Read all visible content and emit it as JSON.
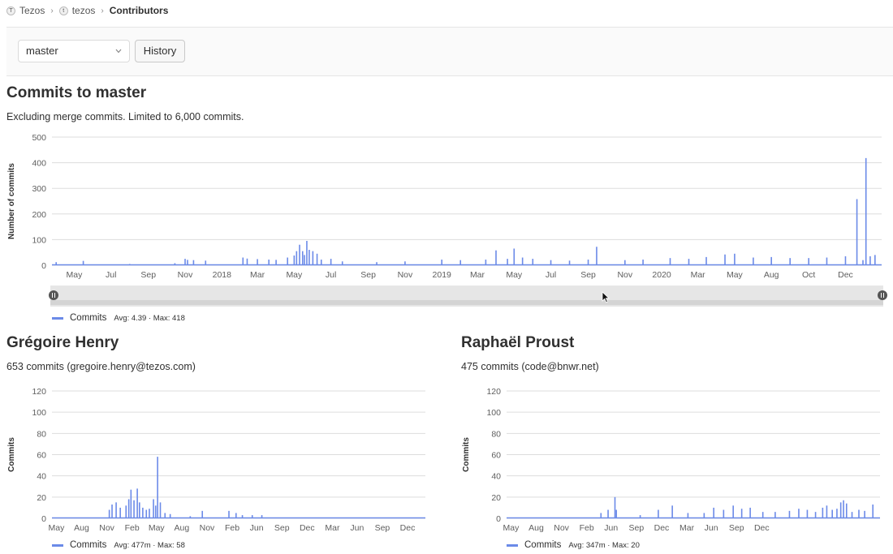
{
  "breadcrumb": {
    "items": [
      "Tezos",
      "tezos",
      "Contributors"
    ]
  },
  "toolbar": {
    "branch": "master",
    "history_label": "History"
  },
  "main": {
    "title": "Commits to master",
    "subtitle": "Excluding merge commits. Limited to 6,000 commits.",
    "legend": {
      "name": "Commits",
      "stats": "Avg: 4.39 · Max: 418"
    }
  },
  "contributors": [
    {
      "name": "Grégoire Henry",
      "summary": "653 commits (gregoire.henry@tezos.com)",
      "legend": {
        "name": "Commits",
        "stats": "Avg: 477m · Max: 58"
      }
    },
    {
      "name": "Raphaël Proust",
      "summary": "475 commits (code@bnwr.net)",
      "legend": {
        "name": "Commits",
        "stats": "Avg: 347m · Max: 20"
      }
    }
  ],
  "colors": {
    "series": "#6b8ae8",
    "grid": "#dddddd",
    "axis_text": "#5e5e5e",
    "slider_bg": "#e6e6e6"
  },
  "chart_data": [
    {
      "type": "area",
      "ylabel": "Number of commits",
      "ylim": [
        0,
        500
      ],
      "yticks": [
        0,
        100,
        200,
        300,
        400,
        500
      ],
      "x_ticks": [
        "May",
        "Jul",
        "Sep",
        "Nov",
        "2018",
        "Mar",
        "May",
        "Jul",
        "Sep",
        "Nov",
        "2019",
        "Mar",
        "May",
        "Jul",
        "Sep",
        "Nov",
        "2020",
        "Mar",
        "May",
        "Aug",
        "Oct",
        "Dec"
      ],
      "series": [
        {
          "name": "Commits",
          "x": [
            "2017-04-01",
            "2017-05-16",
            "2017-08-01",
            "2017-10-15",
            "2017-11-01",
            "2017-11-05",
            "2017-11-15",
            "2017-12-05",
            "2018-02-05",
            "2018-02-12",
            "2018-03-01",
            "2018-03-20",
            "2018-04-01",
            "2018-04-20",
            "2018-05-01",
            "2018-05-05",
            "2018-05-10",
            "2018-05-15",
            "2018-05-18",
            "2018-05-22",
            "2018-05-26",
            "2018-06-01",
            "2018-06-08",
            "2018-06-15",
            "2018-07-01",
            "2018-07-20",
            "2018-09-15",
            "2018-11-01",
            "2019-01-01",
            "2019-02-01",
            "2019-03-15",
            "2019-04-01",
            "2019-04-20",
            "2019-05-01",
            "2019-05-15",
            "2019-06-01",
            "2019-07-01",
            "2019-08-01",
            "2019-09-01",
            "2019-09-15",
            "2019-11-01",
            "2019-12-01",
            "2020-01-15",
            "2020-02-15",
            "2020-03-15",
            "2020-04-15",
            "2020-05-01",
            "2020-06-01",
            "2020-07-01",
            "2020-08-01",
            "2020-09-01",
            "2020-10-01",
            "2020-11-01",
            "2020-11-20",
            "2020-11-30",
            "2020-12-05",
            "2020-12-12",
            "2020-12-20"
          ],
          "values": [
            12,
            17,
            5,
            8,
            25,
            21,
            20,
            18,
            30,
            26,
            24,
            22,
            21,
            30,
            38,
            55,
            80,
            55,
            40,
            95,
            60,
            55,
            45,
            22,
            25,
            15,
            12,
            15,
            22,
            20,
            22,
            58,
            25,
            65,
            30,
            25,
            20,
            18,
            22,
            72,
            20,
            22,
            28,
            25,
            32,
            42,
            45,
            30,
            32,
            28,
            28,
            30,
            35,
            258,
            20,
            418,
            35,
            40
          ]
        }
      ]
    },
    {
      "type": "area",
      "ylabel": "Commits",
      "ylim": [
        0,
        120
      ],
      "yticks": [
        0,
        20,
        40,
        60,
        80,
        100,
        120
      ],
      "x_ticks": [
        "May",
        "Aug",
        "Nov",
        "Feb",
        "May",
        "Aug",
        "Nov",
        "Feb",
        "Jun",
        "Sep",
        "Dec",
        "Mar",
        "Jun",
        "Sep",
        "Dec"
      ],
      "series": [
        {
          "name": "Commits",
          "x": [
            "2017-11-10",
            "2017-11-20",
            "2017-12-05",
            "2017-12-20",
            "2018-01-10",
            "2018-01-20",
            "2018-01-28",
            "2018-02-08",
            "2018-02-20",
            "2018-02-28",
            "2018-03-12",
            "2018-03-25",
            "2018-04-05",
            "2018-04-20",
            "2018-04-28",
            "2018-05-05",
            "2018-05-15",
            "2018-06-01",
            "2018-06-20",
            "2018-09-01",
            "2018-10-15",
            "2019-01-20",
            "2019-02-15",
            "2019-03-10",
            "2019-04-15",
            "2019-05-20"
          ],
          "values": [
            8,
            13,
            15,
            10,
            12,
            18,
            27,
            17,
            28,
            15,
            10,
            8,
            9,
            18,
            12,
            58,
            15,
            5,
            4,
            2,
            7,
            7,
            5,
            3,
            3,
            3
          ]
        }
      ]
    },
    {
      "type": "area",
      "ylabel": "Commits",
      "ylim": [
        0,
        120
      ],
      "yticks": [
        0,
        20,
        40,
        60,
        80,
        100,
        120
      ],
      "x_ticks": [
        "May",
        "Aug",
        "Nov",
        "Feb",
        "Jun",
        "Sep",
        "Dec",
        "Mar",
        "Jun",
        "Sep",
        "Dec"
      ],
      "series": [
        {
          "name": "Commits",
          "x": [
            "2018-03-25",
            "2018-04-20",
            "2018-05-15",
            "2018-05-20",
            "2018-08-15",
            "2018-10-20",
            "2018-12-10",
            "2019-02-05",
            "2019-04-05",
            "2019-05-10",
            "2019-06-15",
            "2019-07-20",
            "2019-08-20",
            "2019-09-20",
            "2019-11-05",
            "2019-12-20",
            "2020-02-10",
            "2020-03-15",
            "2020-04-15",
            "2020-05-15",
            "2020-06-10",
            "2020-06-25",
            "2020-07-15",
            "2020-08-01",
            "2020-08-15",
            "2020-08-25",
            "2020-09-05",
            "2020-09-25",
            "2020-10-20",
            "2020-11-10",
            "2020-12-10"
          ],
          "values": [
            5,
            8,
            20,
            8,
            3,
            8,
            12,
            5,
            5,
            10,
            8,
            12,
            9,
            10,
            6,
            6,
            7,
            9,
            8,
            6,
            10,
            12,
            8,
            9,
            15,
            17,
            14,
            6,
            8,
            7,
            13
          ]
        }
      ]
    }
  ]
}
